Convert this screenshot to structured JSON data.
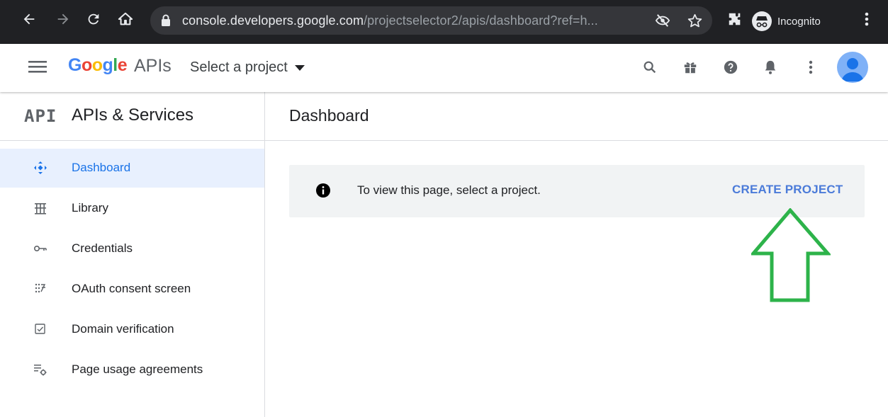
{
  "browser": {
    "url_host": "console.developers.google.com",
    "url_path": "/projectselector2/apis/dashboard?ref=h...",
    "incognito_label": "Incognito"
  },
  "header": {
    "logo_letters": [
      "G",
      "o",
      "o",
      "g",
      "l",
      "e"
    ],
    "logo_suffix": "APIs",
    "project_selector": "Select a project"
  },
  "sidebar": {
    "logo": "API",
    "title": "APIs & Services",
    "items": [
      {
        "label": "Dashboard",
        "icon": "dashboard-icon",
        "active": true
      },
      {
        "label": "Library",
        "icon": "library-icon",
        "active": false
      },
      {
        "label": "Credentials",
        "icon": "key-icon",
        "active": false
      },
      {
        "label": "OAuth consent screen",
        "icon": "consent-icon",
        "active": false
      },
      {
        "label": "Domain verification",
        "icon": "checkbox-icon",
        "active": false
      },
      {
        "label": "Page usage agreements",
        "icon": "settings-list-icon",
        "active": false
      }
    ]
  },
  "main": {
    "title": "Dashboard",
    "notice": {
      "message": "To view this page, select a project.",
      "action": "CREATE PROJECT"
    }
  },
  "colors": {
    "accent": "#1a73e8",
    "cta": "#4b7bd9",
    "arrow": "#2db34a",
    "chrome": "#202124"
  }
}
